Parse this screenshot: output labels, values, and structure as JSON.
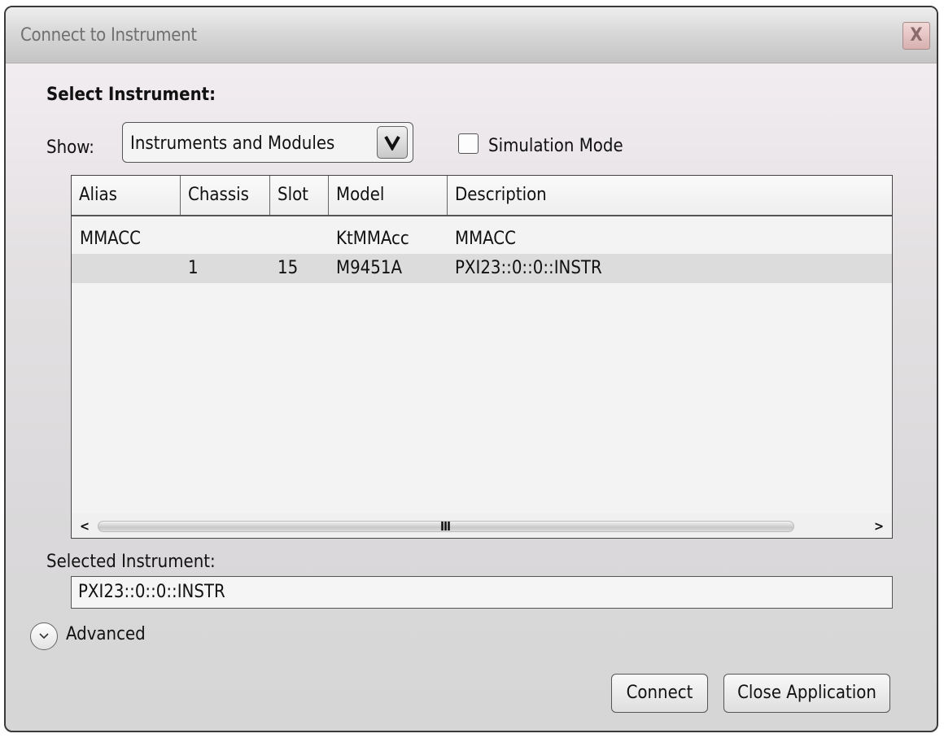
{
  "window": {
    "title": "Connect to Instrument",
    "close_label": "X"
  },
  "select_instrument": {
    "heading": "Select Instrument:",
    "show_label": "Show:",
    "show_value": "Instruments and Modules",
    "simulation_mode_label": "Simulation Mode",
    "simulation_mode_checked": false
  },
  "table": {
    "columns": [
      "Alias",
      "Chassis",
      "Slot",
      "Model",
      "Description"
    ],
    "rows": [
      {
        "alias": "MMACC",
        "chassis": "",
        "slot": "",
        "model": "KtMMAcc",
        "description": "MMACC",
        "selected": false
      },
      {
        "alias": "",
        "chassis": "1",
        "slot": "15",
        "model": "M9451A",
        "description": "PXI23::0::0::INSTR",
        "selected": true
      }
    ],
    "scroll": {
      "left_arrow": "<",
      "right_arrow": ">",
      "grip": "III"
    }
  },
  "selected_instrument": {
    "label": "Selected Instrument:",
    "value": "PXI23::0::0::INSTR"
  },
  "advanced": {
    "label": "Advanced",
    "icon": "chevron-down-icon"
  },
  "buttons": {
    "connect": "Connect",
    "close_application": "Close Application"
  }
}
